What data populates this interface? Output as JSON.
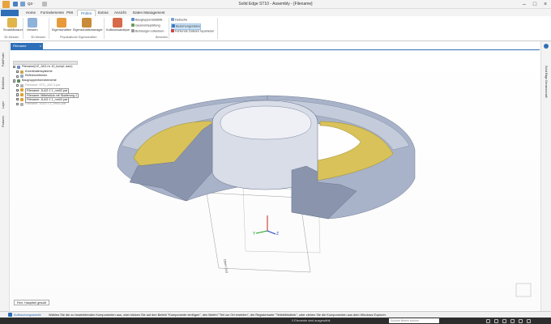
{
  "titlebar": {
    "title": "Solid Edge ST10 - Assembly - [Filename]",
    "qat_dropdown": "Q3 ·",
    "minimize": "–",
    "maximize": "□",
    "close": "×"
  },
  "tabs": [
    "Home",
    "Formelemente",
    "PMI",
    "Prüfen",
    "Extras",
    "Ansicht",
    "Daten Management"
  ],
  "active_tab": "Prüfen",
  "ribbon": {
    "smart_measure": "SmartMeasure",
    "measure": "Messen",
    "group_3d": "3D-Messen",
    "group_3d_tools": "3D-Messen",
    "properties": "Eigenschaften",
    "properties_manager": "Eigenschaftsmanager",
    "group_phys": "Physikalische Eigenschaften",
    "collision": "Kollisionsanalyse",
    "bom_stats": "Baugruppenstatistik",
    "geom_check": "Geometrieprüfung",
    "holes_detect": "Bohrungen erkennen",
    "group_check": "Bewerten",
    "debug": "Debuche",
    "resolve": "Beziehungsstatus",
    "missing_files": "Fehlende Dateien reparieren"
  },
  "doc_tab": {
    "label": "Filename",
    "close": "×"
  },
  "left_tabs": [
    "PathFinder",
    "Bibliothek",
    "Layer",
    "Features"
  ],
  "right_tabs": [
    "Solid Edge Gemeinschaft"
  ],
  "pathfinder": {
    "rows": [
      {
        "label": "Filename(VZ_JAG.nv 10_kompl..asm)",
        "indent": 0,
        "check": false,
        "box": false,
        "dim": false
      },
      {
        "label": "Koordinatensysteme",
        "indent": 1,
        "check": true,
        "box": false,
        "dim": false
      },
      {
        "label": "Referenzebenen",
        "indent": 1,
        "check": false,
        "box": false,
        "dim": false
      },
      {
        "label": "Baugruppenformelemente",
        "indent": 0,
        "check": true,
        "box": false,
        "dim": false
      },
      {
        "label": "Filename: STD_JAG 3.par",
        "indent": 1,
        "check": false,
        "box": false,
        "dim": true
      },
      {
        "label": "Filename: JLAG 1 1_nm02.par",
        "indent": 1,
        "check": true,
        "box": true,
        "dim": false
      },
      {
        "label": "Filename: Mittelstück mit Skalierung 1",
        "indent": 1,
        "check": true,
        "box": true,
        "dim": false
      },
      {
        "label": "Filename: JLAG 1 1_nm02.par",
        "indent": 1,
        "check": true,
        "box": true,
        "dim": false
      },
      {
        "label": "Filename: JLAG 1 1_nm02.par",
        "indent": 1,
        "check": false,
        "box": false,
        "dim": true
      }
    ]
  },
  "viewport": {
    "plane_label": "Oben (xy)",
    "triad": {
      "x": "X",
      "y": "Y",
      "z": "Z"
    },
    "main_part_tip": "Ren: Hauptteil gesollt"
  },
  "status": {
    "assistant": "Auftraubungsdaeite",
    "prompt": "Wählen Sie die zu bearbeitenden Komponenten aus, oder klicken Sie auf den Befehl \"Komponente einfügen\", den Befehl \"Teil vor Ort erstellen\", die Registerkarte \"Teilebibliothek\", oder ziehen Sie die Komponenten aus dem Windows Explorer.",
    "selected": "0 Elemente sind ausgewählt",
    "search_placeholder": "Suchen Befehl suchen"
  },
  "colors": {
    "accent": "#2a6db5",
    "part_grey": "#a8b3c9",
    "part_gold": "#d9c25a",
    "statusbar": "#2d2d2d"
  }
}
